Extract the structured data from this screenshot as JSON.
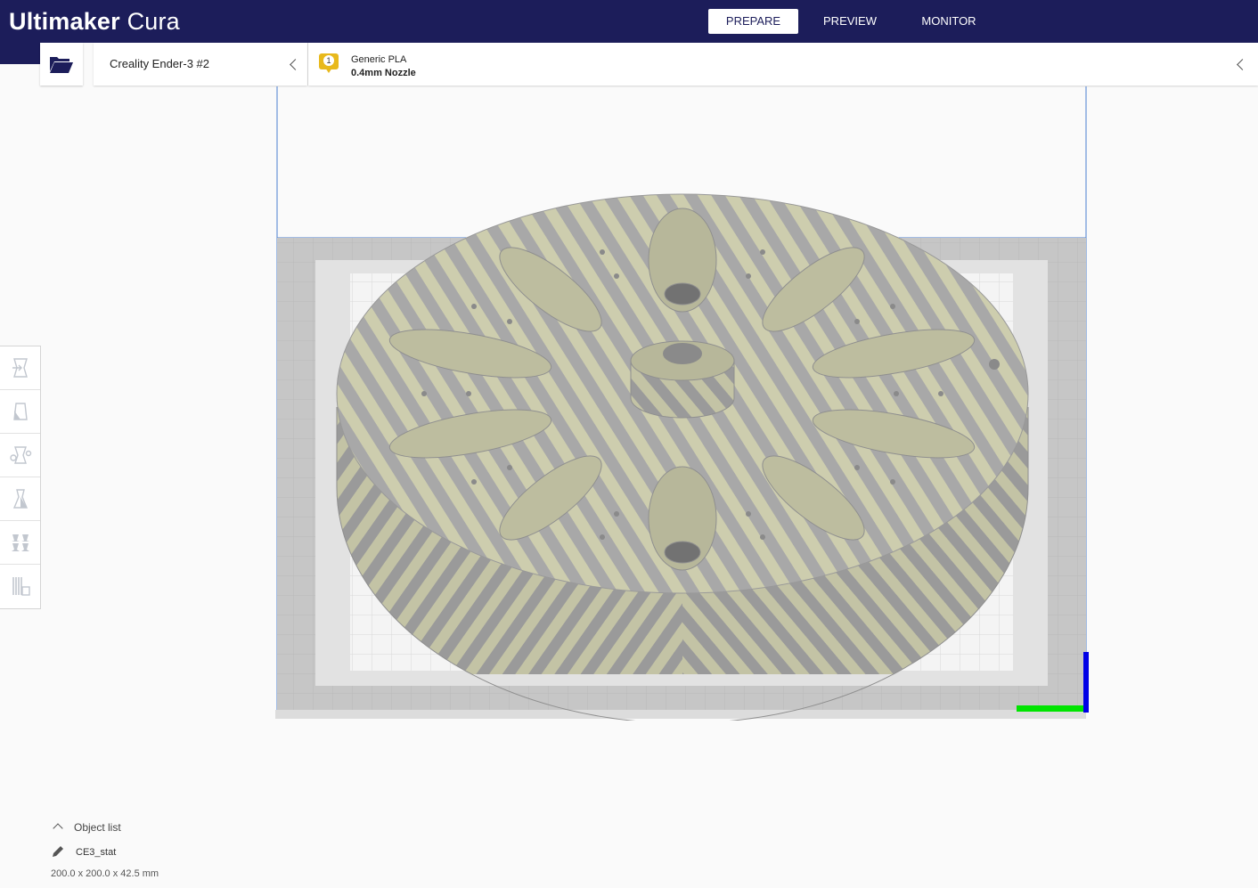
{
  "app": {
    "brand_bold": "Ultimaker",
    "brand_light": "Cura",
    "header_color": "#1c1d5a"
  },
  "stages": [
    {
      "label": "PREPARE",
      "active": true
    },
    {
      "label": "PREVIEW",
      "active": false
    },
    {
      "label": "MONITOR",
      "active": false
    }
  ],
  "toolbar": {
    "open_icon": "folder-open-icon",
    "printer_name": "Creality Ender-3 #2",
    "extruder_number": "1",
    "extruder_color": "#e8b91c",
    "material": "Generic PLA",
    "nozzle": "0.4mm Nozzle"
  },
  "tools": [
    {
      "name": "move-tool",
      "icon": "move-icon"
    },
    {
      "name": "scale-tool",
      "icon": "scale-icon"
    },
    {
      "name": "rotate-tool",
      "icon": "rotate-icon"
    },
    {
      "name": "mirror-tool",
      "icon": "mirror-icon"
    },
    {
      "name": "per-model-settings-tool",
      "icon": "per-model-settings-icon"
    },
    {
      "name": "support-blocker-tool",
      "icon": "support-blocker-icon"
    }
  ],
  "object_list": {
    "label": "Object list",
    "object_name": "CE3_stat",
    "dimensions": "200.0 x 200.0 x 42.5 mm"
  },
  "model": {
    "stripe_light": "#cfcfb0",
    "stripe_dark": "#a6a6a6",
    "buildplate_color": "#c4c4c4"
  }
}
